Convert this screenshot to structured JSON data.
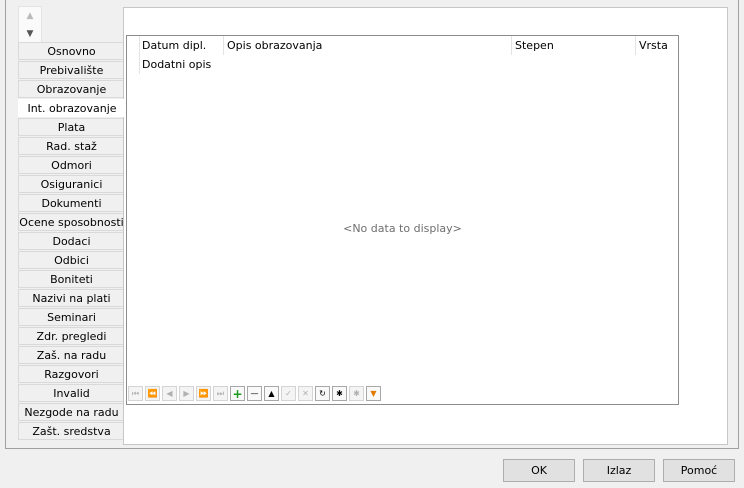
{
  "tabs": [
    {
      "label": "Osnovno"
    },
    {
      "label": "Prebivalište"
    },
    {
      "label": "Obrazovanje"
    },
    {
      "label": "Int. obrazovanje",
      "active": true
    },
    {
      "label": "Plata"
    },
    {
      "label": "Rad. staž"
    },
    {
      "label": "Odmori"
    },
    {
      "label": "Osiguranici"
    },
    {
      "label": "Dokumenti"
    },
    {
      "label": "Ocene sposobnosti"
    },
    {
      "label": "Dodaci"
    },
    {
      "label": "Odbici"
    },
    {
      "label": "Boniteti"
    },
    {
      "label": "Nazivi na plati"
    },
    {
      "label": "Seminari"
    },
    {
      "label": "Zdr. pregledi"
    },
    {
      "label": "Zaš. na radu"
    },
    {
      "label": "Razgovori"
    },
    {
      "label": "Invalid"
    },
    {
      "label": "Nezgode na radu"
    },
    {
      "label": "Zašt. sredstva"
    }
  ],
  "grid": {
    "columns": [
      "Datum dipl.",
      "Opis obrazovanja",
      "Stepen",
      "Vrsta"
    ],
    "second_row_column": "Dodatni opis",
    "empty_text": "<No data to display>"
  },
  "navigator": {
    "buttons": [
      "first-record",
      "prev-page",
      "prev-record",
      "next-record",
      "next-page",
      "last-record",
      "insert",
      "delete",
      "edit",
      "post",
      "cancel",
      "refresh",
      "save-bookmark",
      "goto-bookmark",
      "filter"
    ]
  },
  "footer": {
    "ok": "OK",
    "exit": "Izlaz",
    "help": "Pomoć"
  }
}
